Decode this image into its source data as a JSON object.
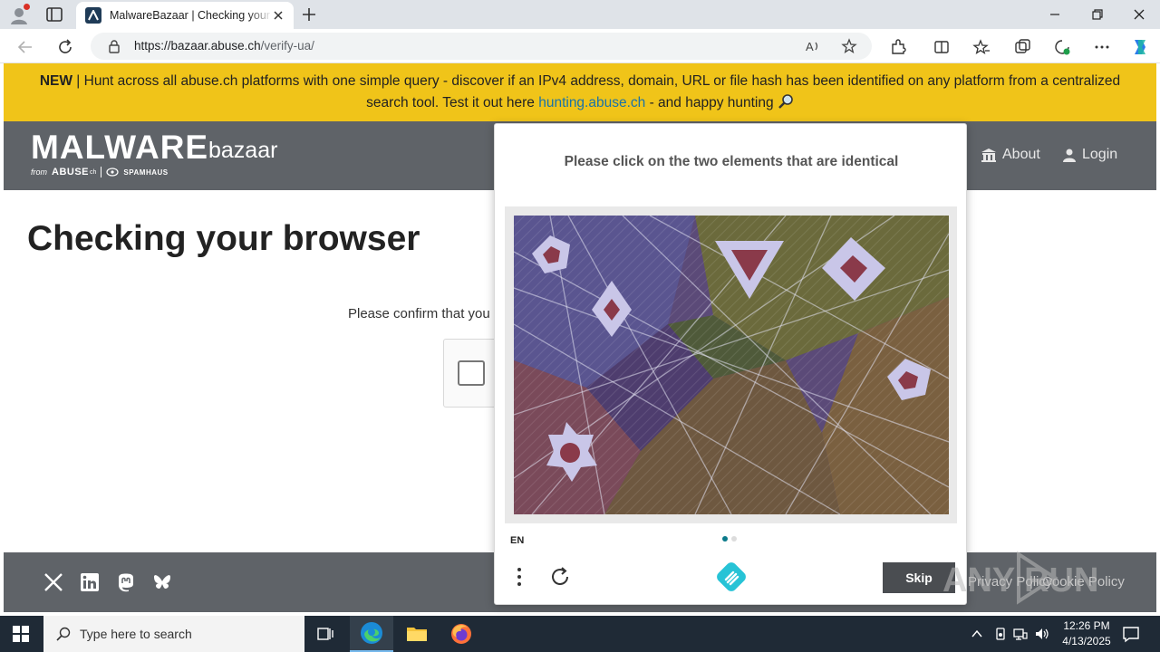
{
  "browser": {
    "tab_title": "MalwareBazaar | Checking your browser",
    "url_host": "https://bazaar.abuse.ch",
    "url_path": "/verify-ua/"
  },
  "banner": {
    "new_label": "NEW",
    "text_before": " | Hunt across all abuse.ch platforms with one simple query - discover if an IPv4 address, domain, URL or file hash has been identified on any platform from a centralized search tool. Test it out here ",
    "link_text": "hunting.abuse.ch",
    "text_after": " - and happy hunting "
  },
  "navbar": {
    "logo_main": "MALWARE",
    "logo_sub": "bazaar",
    "logo_from": "from",
    "logo_abuse": "ABUSE",
    "logo_abuse_suffix": "ch",
    "logo_spamhaus": "SPAMHAUS",
    "about_label": "About",
    "login_label": "Login"
  },
  "main": {
    "heading": "Checking your browser",
    "confirm_text": "Please confirm that you"
  },
  "challenge": {
    "prompt": "Please click on the two elements that are identical",
    "language": "EN",
    "skip_label": "Skip",
    "page_count": 2,
    "current_page": 1
  },
  "footer": {
    "privacy_link": "Privacy Policy",
    "separator": "|",
    "cookie_link": "Cookie Policy"
  },
  "taskbar": {
    "search_placeholder": "Type here to search",
    "time": "12:26 PM",
    "date": "4/13/2025"
  },
  "watermark": {
    "text": "ANY RUN"
  },
  "colors": {
    "banner_bg": "#f0c419",
    "navbar_bg": "#5f6368",
    "link": "#1a73a8",
    "accent_teal": "#0b7a8a",
    "taskbar_bg": "#1f2a36"
  }
}
